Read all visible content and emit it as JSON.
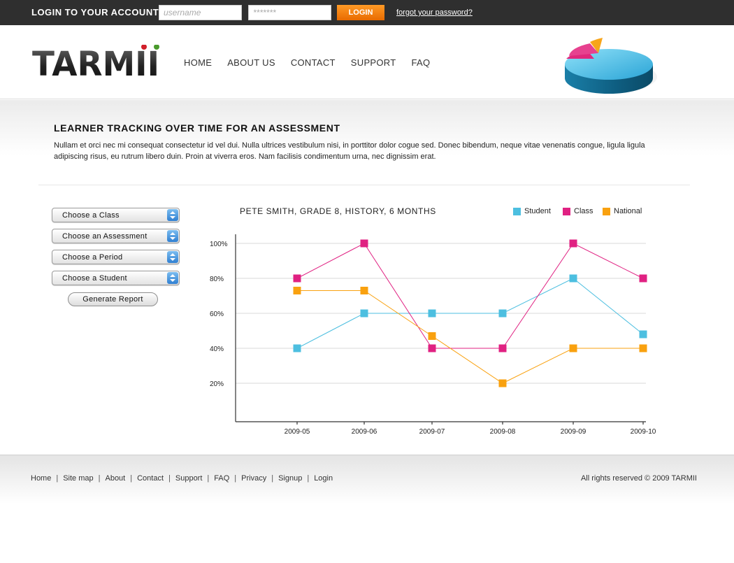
{
  "login": {
    "title": "LOGIN TO YOUR ACCOUNT",
    "username_placeholder": "username",
    "password_placeholder": "*******",
    "button_label": "LOGIN",
    "forgot_link": "forgot your password?"
  },
  "header": {
    "logo_text": "TARMII",
    "nav": [
      "HOME",
      "ABOUT US",
      "CONTACT",
      "SUPPORT",
      "FAQ"
    ]
  },
  "intro": {
    "title": "LEARNER TRACKING OVER TIME FOR AN ASSESSMENT",
    "text": "Nullam et orci nec mi consequat consectetur id vel dui. Nulla ultrices vestibulum nisi, in porttitor dolor cogue sed. Donec bibendum, neque vitae venenatis congue, ligula ligula adipiscing risus, eu rutrum libero duin. Proin at viverra eros. Nam facilisis condimentum urna, nec dignissim erat."
  },
  "filters": {
    "class": "Choose a Class",
    "assessment": "Choose an Assessment",
    "period": "Choose a Period",
    "student": "Choose a Student",
    "generate": "Generate Report"
  },
  "chart_data": {
    "type": "line",
    "title": "PETE SMITH, GRADE 8, HISTORY, 6 MONTHS",
    "x": [
      "2009-05",
      "2009-06",
      "2009-07",
      "2009-08",
      "2009-09",
      "2009-10"
    ],
    "y_ticks": [
      "100%",
      "80%",
      "60%",
      "40%",
      "20%"
    ],
    "ylim": [
      0,
      100
    ],
    "grid": true,
    "legend_position": "top-right",
    "series": [
      {
        "name": "Student",
        "color": "#4dbfe0",
        "values": [
          40,
          60,
          60,
          60,
          80,
          48
        ]
      },
      {
        "name": "Class",
        "color": "#e02182",
        "values": [
          80,
          100,
          40,
          40,
          100,
          80
        ]
      },
      {
        "name": "National",
        "color": "#f9a10f",
        "values": [
          73,
          73,
          47,
          20,
          40,
          40
        ]
      }
    ]
  },
  "footer": {
    "links": [
      "Home",
      "Site map",
      "About",
      "Contact",
      "Support",
      "FAQ",
      "Privacy",
      "Signup",
      "Login"
    ],
    "copyright": "All rights reserved © 2009 TARMII"
  }
}
